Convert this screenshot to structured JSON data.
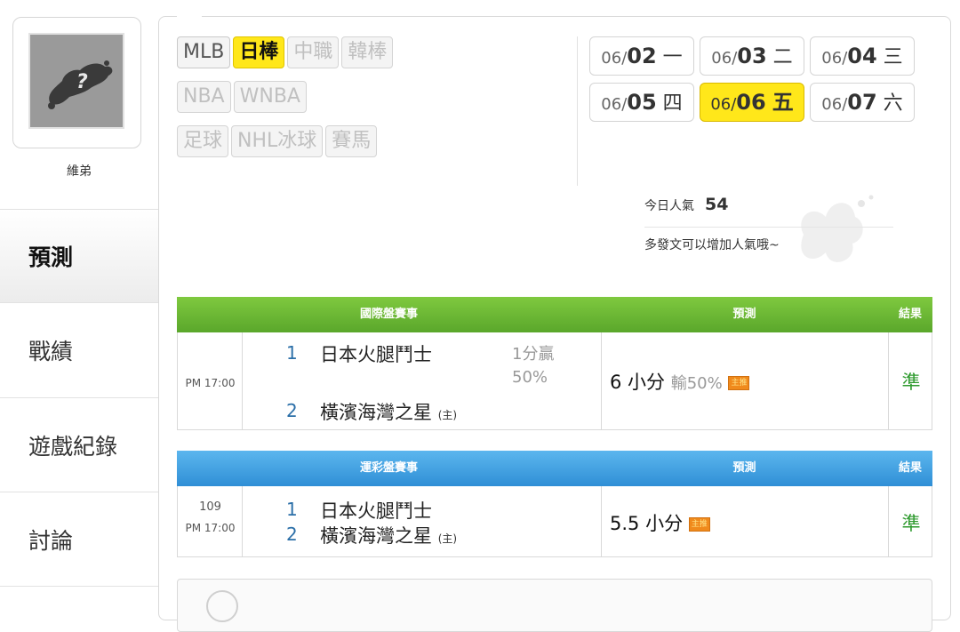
{
  "user": {
    "name": "維弟"
  },
  "nav": [
    {
      "label": "預測",
      "active": true
    },
    {
      "label": "戰績",
      "active": false
    },
    {
      "label": "遊戲紀錄",
      "active": false
    },
    {
      "label": "討論",
      "active": false
    }
  ],
  "leagues": [
    {
      "label": "MLB",
      "state": "on"
    },
    {
      "label": "日棒",
      "state": "selected"
    },
    {
      "label": "中職",
      "state": "off"
    },
    {
      "label": "韓棒",
      "state": "off"
    },
    {
      "label": "NBA",
      "state": "off"
    },
    {
      "label": "WNBA",
      "state": "off"
    },
    {
      "label": "足球",
      "state": "off"
    },
    {
      "label": "NHL冰球",
      "state": "off"
    },
    {
      "label": "賽馬",
      "state": "off"
    }
  ],
  "dates": [
    {
      "md": "06/",
      "day": "02",
      "wd": "一",
      "selected": false
    },
    {
      "md": "06/",
      "day": "03",
      "wd": "二",
      "selected": false
    },
    {
      "md": "06/",
      "day": "04",
      "wd": "三",
      "selected": false
    },
    {
      "md": "06/",
      "day": "05",
      "wd": "四",
      "selected": false
    },
    {
      "md": "06/",
      "day": "06",
      "wd": "五",
      "selected": true
    },
    {
      "md": "06/",
      "day": "07",
      "wd": "六",
      "selected": false
    }
  ],
  "popularity": {
    "label": "今日人氣",
    "value": "54",
    "hint": "多發文可以增加人氣哦~"
  },
  "international": {
    "header": {
      "event": "國際盤賽事",
      "prediction": "預測",
      "result": "結果"
    },
    "time": "PM 17:00",
    "teams": [
      {
        "num": "1",
        "name": "日本火腿鬥士",
        "home": ""
      },
      {
        "num": "2",
        "name": "橫濱海灣之星",
        "home": "(主)"
      }
    ],
    "odds": [
      "1分贏",
      "50%"
    ],
    "prediction": "6 小分",
    "prediction_sub": "輸50%",
    "tag": "主推",
    "result": "準"
  },
  "sportslottery": {
    "header": {
      "event": "運彩盤賽事",
      "prediction": "預測",
      "result": "結果"
    },
    "game_no": "109",
    "time": "PM 17:00",
    "teams": [
      {
        "num": "1",
        "name": "日本火腿鬥士",
        "home": ""
      },
      {
        "num": "2",
        "name": "橫濱海灣之星",
        "home": "(主)"
      }
    ],
    "prediction": "5.5 小分",
    "tag": "主推",
    "result": "準"
  },
  "colors": {
    "accent_yellow": "#ffe71a",
    "green_header": "#6cb935",
    "blue_header": "#42a3e4",
    "result_green": "#2e9a2e"
  }
}
